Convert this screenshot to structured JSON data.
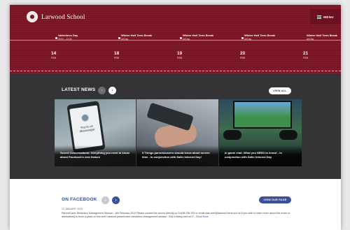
{
  "header": {
    "school_name": "Larwood School",
    "menu_label": "MENU"
  },
  "events": [
    {
      "title": "Valentines Day",
      "time": "09:00 – 12:00"
    },
    {
      "title": "Winter Half Term Break",
      "time": "All Day"
    },
    {
      "title": "Winter Half Term Break",
      "time": "All Day"
    },
    {
      "title": "Winter Half Term Break",
      "time": "All Day"
    },
    {
      "title": "Winter Half Term Break",
      "time": "All Day"
    }
  ],
  "dates": [
    {
      "day": "14",
      "month": "FEB"
    },
    {
      "day": "18",
      "month": "FEB"
    },
    {
      "day": "19",
      "month": "FEB"
    },
    {
      "day": "20",
      "month": "FEB"
    },
    {
      "day": "21",
      "month": "FEB"
    }
  ],
  "news": {
    "title": "LATEST NEWS",
    "view_all": "VIEW ALL",
    "prev_glyph": "‹",
    "next_glyph": "›",
    "cards": [
      {
        "caption": "Secret Conversations: everything you need to know about Facebook’s new feature",
        "screen_text": "You’re on Messenger"
      },
      {
        "caption": "5 Things parents/carers should know about screen time - in conjunction with Safer Internet Day!"
      },
      {
        "caption": "In game chat: What you NEED to know! - In conjunction with Safer Internet Day"
      }
    ]
  },
  "facebook": {
    "title": "ON FACEBOOK",
    "view_page": "VIEW OUR PAGE",
    "prev_glyph": "‹",
    "next_glyph": "›",
    "post_date": "13 JANUARY 2019",
    "post_text": "Parent/Carer Behaviour Management Session - 8th February 2019 Please contact the school directly on 01438 236 333 or email stan.terri@larwood.herts.sch.uk if you wish to learn more about this event or alternatively to book a place on the next Larwood parent/carer behaviour management session. This is being held on F...",
    "read_more": "Read More"
  },
  "colors": {
    "brand_maroon": "#7c1424",
    "news_bg": "#343437",
    "facebook_blue": "#3a5197"
  }
}
